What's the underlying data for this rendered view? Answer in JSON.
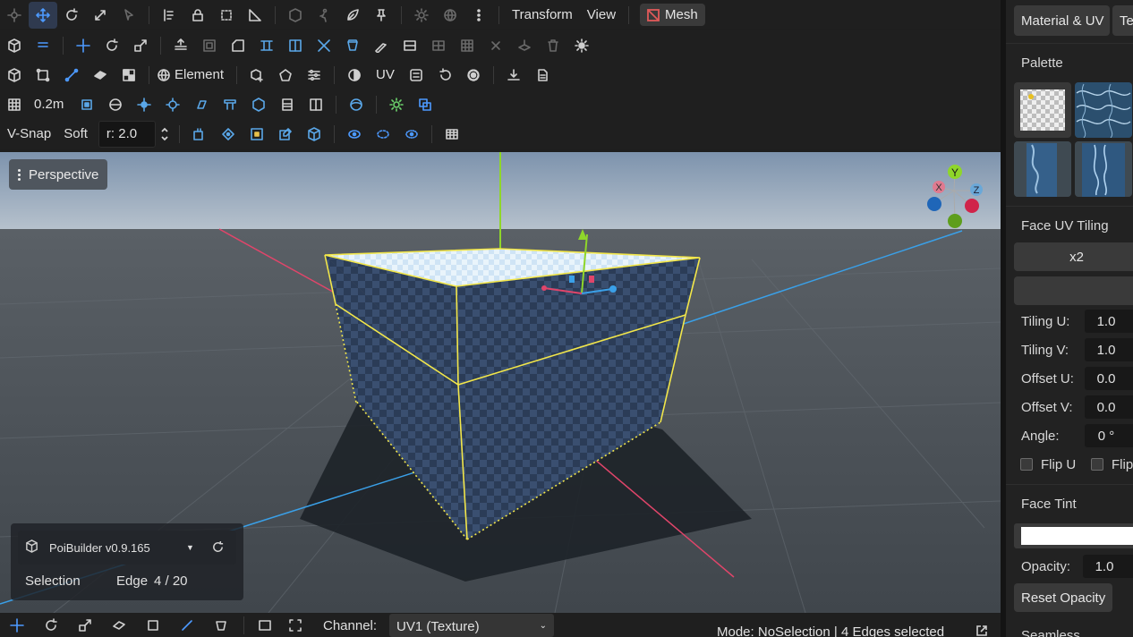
{
  "toolbar": {
    "transform_menu": "Transform",
    "view_menu": "View",
    "mesh_button": "Mesh",
    "element_label": "Element",
    "uv_label": "UV",
    "grid_size": "0.2m",
    "vsnap_label": "V-Snap",
    "soft_label": "Soft",
    "radius_value": "r: 2.0"
  },
  "viewport": {
    "perspective_label": "Perspective",
    "gizmo": {
      "y": "Y",
      "x": "X",
      "z": "Z"
    },
    "info": {
      "app_version": "PoiBuilder v0.9.165",
      "selection_label": "Selection",
      "selection_mode": "Edge",
      "selection_count": "4 / 20"
    }
  },
  "statusbar": {
    "channel_label": "Channel:",
    "channel_value": "UV1 (Texture)",
    "mode_text": "Mode: NoSelection | 4 Edges selected"
  },
  "panel": {
    "tab_material": "Material & UV",
    "tab_texture": "Te",
    "palette_title": "Palette",
    "face_uv_tiling_title": "Face UV Tiling",
    "tiling_x2": "x2",
    "tiling_u_label": "Tiling U:",
    "tiling_u_value": "1.0",
    "tiling_v_label": "Tiling V:",
    "tiling_v_value": "1.0",
    "offset_u_label": "Offset U:",
    "offset_u_value": "0.0",
    "offset_v_label": "Offset V:",
    "offset_v_value": "0.0",
    "angle_label": "Angle:",
    "angle_value": "0 °",
    "flip_u_label": "Flip U",
    "flip_v_label": "Flip",
    "face_tint_title": "Face Tint",
    "face_tint_color": "#ffffff",
    "opacity_label": "Opacity:",
    "opacity_value": "1.0",
    "reset_opacity": "Reset Opacity",
    "partial_label": "Seamless Textures"
  },
  "colors": {
    "accent": "#4d9aff",
    "selection_yellow": "#f2e64a",
    "axis_red": "#e0456a",
    "axis_blue": "#3aa0e8",
    "axis_green": "#8fd62a"
  }
}
